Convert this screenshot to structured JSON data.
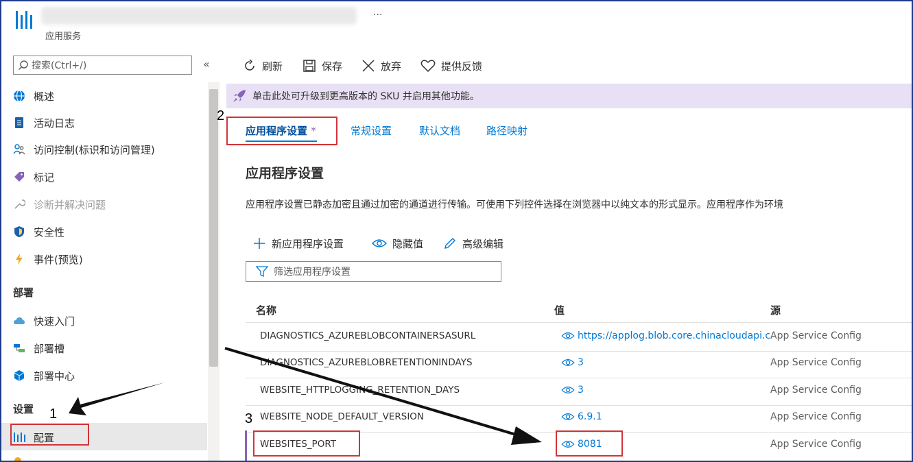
{
  "header": {
    "subtitle": "应用服务",
    "more": "..."
  },
  "sidebar": {
    "search_placeholder": "搜索(Ctrl+/)",
    "collapse": "«",
    "items": [
      {
        "label": "概述",
        "icon": "globe-icon"
      },
      {
        "label": "活动日志",
        "icon": "log-icon"
      },
      {
        "label": "访问控制(标识和访问管理)",
        "icon": "people-icon"
      },
      {
        "label": "标记",
        "icon": "tag-icon"
      },
      {
        "label": "诊断并解决问题",
        "icon": "wrench-icon"
      },
      {
        "label": "安全性",
        "icon": "shield-icon"
      },
      {
        "label": "事件(预览)",
        "icon": "lightning-icon"
      }
    ],
    "section_deploy": "部署",
    "deploy_items": [
      {
        "label": "快速入门",
        "icon": "cloud-icon"
      },
      {
        "label": "部署槽",
        "icon": "slots-icon"
      },
      {
        "label": "部署中心",
        "icon": "cube-icon"
      }
    ],
    "section_settings": "设置",
    "settings_items": [
      {
        "label": "配置",
        "icon": "config-bars-icon"
      }
    ]
  },
  "toolbar": {
    "refresh": "刷新",
    "save": "保存",
    "discard": "放弃",
    "feedback": "提供反馈"
  },
  "banner": {
    "text": "单击此处可升级到更高版本的 SKU 并启用其他功能。"
  },
  "tabs": [
    {
      "label": "应用程序设置",
      "modified": "*"
    },
    {
      "label": "常规设置"
    },
    {
      "label": "默认文档"
    },
    {
      "label": "路径映射"
    }
  ],
  "main": {
    "title": "应用程序设置",
    "description": "应用程序设置已静态加密且通过加密的通道进行传输。可使用下列控件选择在浏览器中以纯文本的形式显示。应用程序作为环境",
    "new_setting": "新应用程序设置",
    "hide_values": "隐藏值",
    "advanced_edit": "高级编辑",
    "filter_placeholder": "筛选应用程序设置"
  },
  "table": {
    "headers": [
      "名称",
      "值",
      "源"
    ],
    "rows": [
      {
        "name": "DIAGNOSTICS_AZUREBLOBCONTAINERSASURL",
        "value": "https://applog.blob.core.chinacloudapi.c",
        "source": "App Service Config"
      },
      {
        "name": "DIAGNOSTICS_AZUREBLOBRETENTIONINDAYS",
        "value": "3",
        "source": "App Service Config"
      },
      {
        "name": "WEBSITE_HTTPLOGGING_RETENTION_DAYS",
        "value": "3",
        "source": "App Service Config"
      },
      {
        "name": "WEBSITE_NODE_DEFAULT_VERSION",
        "value": "6.9.1",
        "source": "App Service Config"
      },
      {
        "name": "WEBSITES_PORT",
        "value": "8081",
        "source": "App Service Config"
      }
    ]
  },
  "annotations": {
    "one": "1",
    "two": "2",
    "three": "3"
  },
  "colors": {
    "accent": "#0078d4",
    "highlight_box": "#d13438",
    "banner_bg": "#e8e0f4"
  }
}
